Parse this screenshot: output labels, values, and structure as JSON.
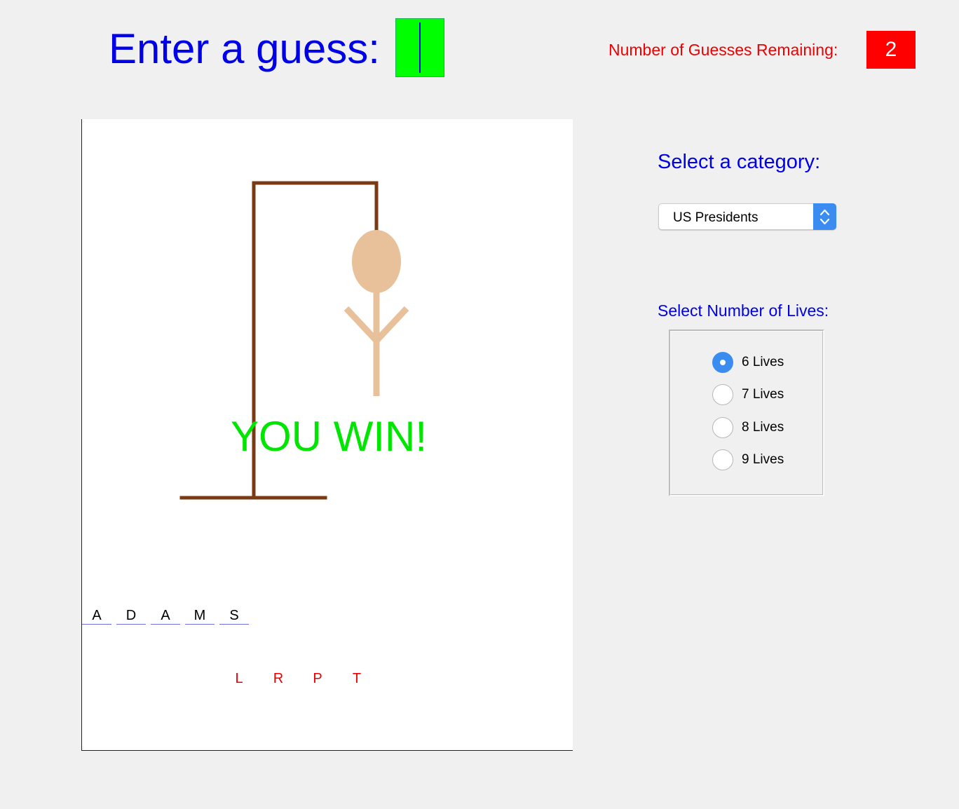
{
  "guess": {
    "label": "Enter a guess:",
    "value": ""
  },
  "remaining": {
    "label": "Number of Guesses Remaining:",
    "value": "2"
  },
  "game": {
    "status_text": "YOU WIN!",
    "word_letters": [
      "A",
      "D",
      "A",
      "M",
      "S"
    ],
    "wrong_letters": [
      "L",
      "R",
      "P",
      "T"
    ]
  },
  "category": {
    "label": "Select a category:",
    "selected": "US Presidents"
  },
  "lives": {
    "label": "Select Number of Lives:",
    "options": [
      "6 Lives",
      "7 Lives",
      "8 Lives",
      "9 Lives"
    ],
    "selected_index": 0
  },
  "colors": {
    "title_blue": "#0000e6",
    "remaining_red": "#ff0000",
    "input_green": "#00ff00",
    "win_green": "#00e600",
    "gallows_brown": "#7a3b14",
    "figure_skin": "#e8c09a",
    "accent_blue": "#3b8cf0"
  }
}
